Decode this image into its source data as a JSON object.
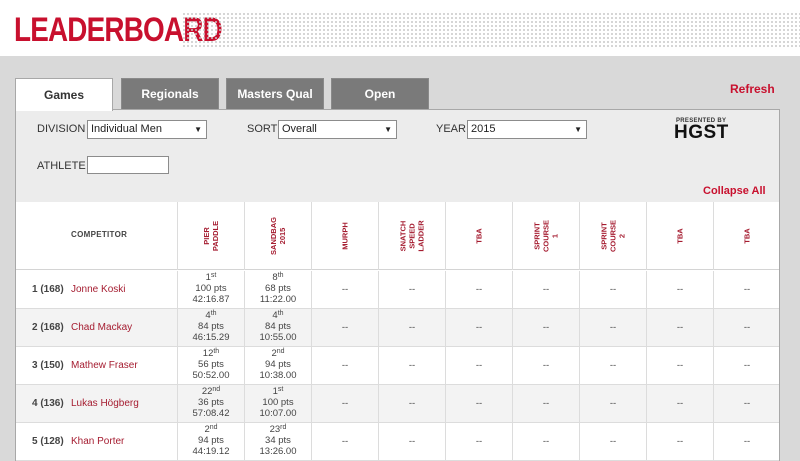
{
  "header": {
    "title": "LEADERBOARD"
  },
  "tabs": [
    {
      "label": "Games",
      "active": true
    },
    {
      "label": "Regionals",
      "active": false
    },
    {
      "label": "Masters Qual",
      "active": false
    },
    {
      "label": "Open",
      "active": false
    }
  ],
  "refresh_label": "Refresh",
  "filters": {
    "division_label": "DIVISION",
    "division_value": "Individual Men",
    "sort_label": "SORT",
    "sort_value": "Overall",
    "year_label": "YEAR",
    "year_value": "2015",
    "athlete_label": "ATHLETE",
    "athlete_value": ""
  },
  "sponsor": {
    "presented_by": "PRESENTED BY",
    "name": "HGST"
  },
  "collapse_label": "Collapse All",
  "table": {
    "competitor_header": "COMPETITOR",
    "events": [
      "PIER\nPADDLE",
      "SANDBAG\n2015",
      "MURPH",
      "SNATCH\nSPEED\nLADDER",
      "TBA",
      "SPRINT\nCOURSE\n1",
      "SPRINT\nCOURSE\n2",
      "TBA",
      "TBA"
    ],
    "rows": [
      {
        "rank": "1 (168)",
        "name": "Jonne Koski",
        "results": [
          {
            "place": "1",
            "suffix": "st",
            "pts": "100 pts",
            "time": "42:16.87"
          },
          {
            "place": "8",
            "suffix": "th",
            "pts": "68 pts",
            "time": "11:22.00"
          }
        ],
        "empty": "--"
      },
      {
        "rank": "2 (168)",
        "name": "Chad Mackay",
        "results": [
          {
            "place": "4",
            "suffix": "th",
            "pts": "84 pts",
            "time": "46:15.29"
          },
          {
            "place": "4",
            "suffix": "th",
            "pts": "84 pts",
            "time": "10:55.00"
          }
        ],
        "empty": "--"
      },
      {
        "rank": "3 (150)",
        "name": "Mathew Fraser",
        "results": [
          {
            "place": "12",
            "suffix": "th",
            "pts": "56 pts",
            "time": "50:52.00"
          },
          {
            "place": "2",
            "suffix": "nd",
            "pts": "94 pts",
            "time": "10:38.00"
          }
        ],
        "empty": "--"
      },
      {
        "rank": "4 (136)",
        "name": "Lukas Högberg",
        "results": [
          {
            "place": "22",
            "suffix": "nd",
            "pts": "36 pts",
            "time": "57:08.42"
          },
          {
            "place": "1",
            "suffix": "st",
            "pts": "100 pts",
            "time": "10:07.00"
          }
        ],
        "empty": "--"
      },
      {
        "rank": "5 (128)",
        "name": "Khan Porter",
        "results": [
          {
            "place": "2",
            "suffix": "nd",
            "pts": "94 pts",
            "time": "44:19.12"
          },
          {
            "place": "23",
            "suffix": "rd",
            "pts": "34 pts",
            "time": "13:26.00"
          }
        ],
        "empty": "--"
      }
    ]
  }
}
